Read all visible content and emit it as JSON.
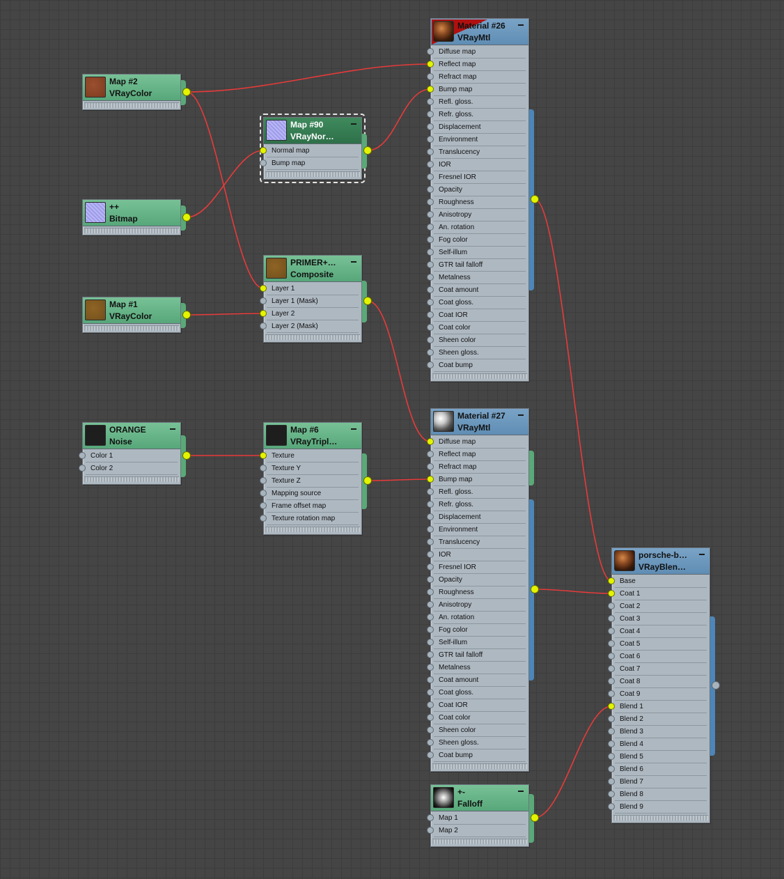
{
  "nodes": {
    "map2": {
      "title": "Map #2",
      "type": "VRayColor",
      "thumb": "brown-swatch"
    },
    "bitmap": {
      "title": "++",
      "type": "Bitmap",
      "thumb": "lavender-noise-texture"
    },
    "map1": {
      "title": "Map #1",
      "type": "VRayColor",
      "thumb": "ochre-swatch"
    },
    "orange": {
      "title": "ORANGE",
      "type": "Noise",
      "thumb": "black-swatch",
      "slots": [
        "Color 1",
        "Color 2"
      ]
    },
    "map90": {
      "title": "Map #90",
      "type": "VRayNor…",
      "thumb": "lavender-noise-texture",
      "slots": [
        "Normal map",
        "Bump map"
      ]
    },
    "primer": {
      "title": "PRIMER+…",
      "type": "Composite",
      "thumb": "ochre-swatch",
      "slots": [
        "Layer 1",
        "Layer 1 (Mask)",
        "Layer 2",
        "Layer 2 (Mask)"
      ]
    },
    "map6": {
      "title": "Map #6",
      "type": "VRayTripl…",
      "thumb": "black-swatch",
      "slots": [
        "Texture",
        "Texture Y",
        "Texture Z",
        "Mapping source",
        "Frame offset map",
        "Texture rotation map"
      ]
    },
    "mat26": {
      "title": "Material #26",
      "type": "VRayMtl",
      "thumb": "copper-sphere",
      "slots": [
        "Diffuse map",
        "Reflect map",
        "Refract map",
        "Bump map",
        "Refl. gloss.",
        "Refr. gloss.",
        "Displacement",
        "Environment",
        "Translucency",
        "IOR",
        "Fresnel IOR",
        "Opacity",
        "Roughness",
        "Anisotropy",
        "An. rotation",
        "Fog color",
        "Self-illum",
        "GTR tail falloff",
        "Metalness",
        "Coat amount",
        "Coat gloss.",
        "Coat IOR",
        "Coat color",
        "Sheen color",
        "Sheen gloss.",
        "Coat bump"
      ]
    },
    "mat27": {
      "title": "Material #27",
      "type": "VRayMtl",
      "thumb": "chrome-sphere",
      "slots": [
        "Diffuse map",
        "Reflect map",
        "Refract map",
        "Bump map",
        "Refl. gloss.",
        "Refr. gloss.",
        "Displacement",
        "Environment",
        "Translucency",
        "IOR",
        "Fresnel IOR",
        "Opacity",
        "Roughness",
        "Anisotropy",
        "An. rotation",
        "Fog color",
        "Self-illum",
        "GTR tail falloff",
        "Metalness",
        "Coat amount",
        "Coat gloss.",
        "Coat IOR",
        "Coat color",
        "Sheen color",
        "Sheen gloss.",
        "Coat bump"
      ]
    },
    "falloff": {
      "title": "+-",
      "type": "Falloff",
      "thumb": "falloff-gradient",
      "slots": [
        "Map 1",
        "Map 2"
      ]
    },
    "porsche": {
      "title": "porsche-b…",
      "type": "VRayBlen…",
      "thumb": "copper-sphere",
      "slots": [
        "Base",
        "Coat 1",
        "Coat 2",
        "Coat 3",
        "Coat 4",
        "Coat 5",
        "Coat 6",
        "Coat 7",
        "Coat 8",
        "Coat 9",
        "Blend 1",
        "Blend 2",
        "Blend 3",
        "Blend 4",
        "Blend 5",
        "Blend 6",
        "Blend 7",
        "Blend 8",
        "Blend 9"
      ]
    }
  },
  "connections": [
    {
      "from": "map2",
      "to": "mat26",
      "slot": "Reflect map"
    },
    {
      "from": "map2",
      "to": "primer",
      "slot": "Layer 1"
    },
    {
      "from": "bitmap",
      "to": "map90",
      "slot": "Normal map"
    },
    {
      "from": "map90",
      "to": "mat26",
      "slot": "Bump map"
    },
    {
      "from": "map1",
      "to": "primer",
      "slot": "Layer 2"
    },
    {
      "from": "primer",
      "to": "mat27",
      "slot": "Diffuse map"
    },
    {
      "from": "orange",
      "to": "map6",
      "slot": "Texture"
    },
    {
      "from": "map6",
      "to": "mat27",
      "slot": "Bump map"
    },
    {
      "from": "mat26",
      "to": "porsche",
      "slot": "Base"
    },
    {
      "from": "mat27",
      "to": "porsche",
      "slot": "Coat 1"
    },
    {
      "from": "falloff",
      "to": "porsche",
      "slot": "Blend 1"
    }
  ],
  "colors": {
    "wire": "#e83a3a",
    "port_connected": "#e3f400",
    "port_empty": "#a7b3bd",
    "material_header": "#6a97bd",
    "map_header": "#65b486"
  }
}
